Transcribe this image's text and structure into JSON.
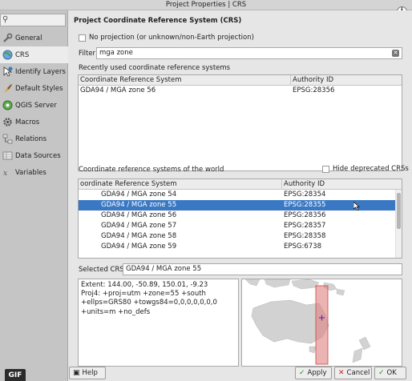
{
  "window": {
    "title": "Project Properties | CRS"
  },
  "sidebar": {
    "items": [
      {
        "label": "General",
        "icon": "wrench-icon"
      },
      {
        "label": "CRS",
        "icon": "globe-icon"
      },
      {
        "label": "Identify Layers",
        "icon": "identify-icon"
      },
      {
        "label": "Default Styles",
        "icon": "styles-icon"
      },
      {
        "label": "QGIS Server",
        "icon": "server-icon"
      },
      {
        "label": "Macros",
        "icon": "gear-icon"
      },
      {
        "label": "Relations",
        "icon": "relations-icon"
      },
      {
        "label": "Data Sources",
        "icon": "datasource-icon"
      },
      {
        "label": "Variables",
        "icon": "variables-icon"
      }
    ],
    "selected": "CRS",
    "badge": "GIF"
  },
  "main": {
    "section_title": "Project Coordinate Reference System (CRS)",
    "no_projection_label": "No projection (or unknown/non-Earth projection)",
    "filter_label": "Filter",
    "filter_value": "mga zone",
    "recent_label": "Recently used coordinate reference systems",
    "recent_headers": [
      "Coordinate Reference System",
      "Authority ID"
    ],
    "recent_rows": [
      {
        "name": "GDA94 / MGA zone 56",
        "id": "EPSG:28356"
      }
    ],
    "world_label": "Coordinate reference systems of the world",
    "hide_deprecated_label": "Hide deprecated CRSs",
    "world_headers": [
      "oordinate Reference System",
      "Authority ID"
    ],
    "world_rows": [
      {
        "name": "GDA94 / MGA zone 54",
        "id": "EPSG:28354",
        "selected": false
      },
      {
        "name": "GDA94 / MGA zone 55",
        "id": "EPSG:28355",
        "selected": true
      },
      {
        "name": "GDA94 / MGA zone 56",
        "id": "EPSG:28356",
        "selected": false
      },
      {
        "name": "GDA94 / MGA zone 57",
        "id": "EPSG:28357",
        "selected": false
      },
      {
        "name": "GDA94 / MGA zone 58",
        "id": "EPSG:28358",
        "selected": false
      },
      {
        "name": "GDA94 / MGA zone 59",
        "id": "EPSG:6738",
        "selected": false
      }
    ],
    "selected_crs_label": "Selected CRS",
    "selected_crs_value": "GDA94 / MGA zone 55",
    "extent_text": "Extent: 144.00, -50.89, 150.01, -9.23",
    "proj4_text": "Proj4: +proj=utm +zone=55 +south +ellps=GRS80 +towgs84=0,0,0,0,0,0,0 +units=m +no_defs",
    "selection_color": "#3a78c3",
    "extent_highlight_color": "#e08080"
  },
  "buttons": {
    "help": "Help",
    "apply": "Apply",
    "cancel": "Cancel",
    "ok": "OK"
  }
}
